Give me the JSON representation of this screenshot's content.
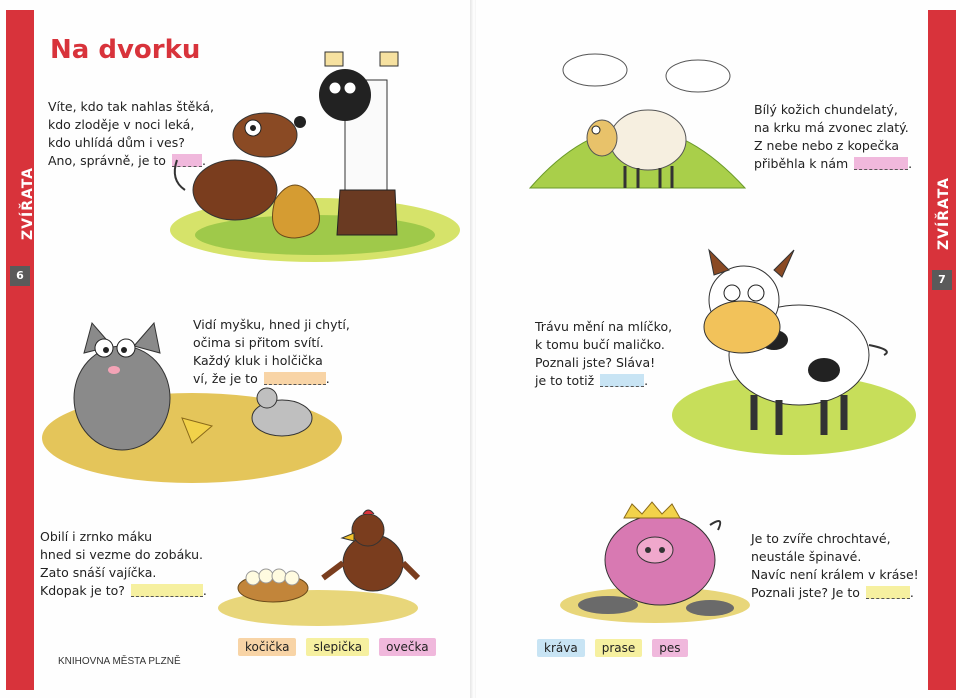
{
  "left_page": {
    "side_label": "ZVÍŘATA",
    "page_number": "6",
    "title": "Na dvorku",
    "poems": [
      {
        "lines": [
          "Víte, kdo tak nahlas štěká,",
          "kdo zloděje v noci leká,",
          "kdo uhlídá dům i ves?",
          "Ano, správně, je to"
        ],
        "blank_color": "#f0b8dc"
      },
      {
        "lines": [
          "Vidí myšku, hned ji chytí,",
          "očima si přitom svítí.",
          "Každý kluk i holčička",
          "ví, že je to"
        ],
        "blank_color": "#f8d4a6"
      },
      {
        "lines": [
          "Obilí i zrnko máku",
          "hned si vezme do zobáku.",
          "Zato snáší vajíčka.",
          "Kdopak je to?"
        ],
        "blank_color": "#f6f0a0"
      }
    ],
    "answer_chips": [
      {
        "label": "kočička",
        "color": "#f8d4a6"
      },
      {
        "label": "slepička",
        "color": "#f6f0a0"
      },
      {
        "label": "ovečka",
        "color": "#f0b8dc"
      }
    ],
    "footer": "KNIHOVNA MĚSTA PLZNĚ"
  },
  "right_page": {
    "side_label": "ZVÍŘATA",
    "page_number": "7",
    "poems": [
      {
        "lines": [
          "Bílý kožich chundelatý,",
          "na krku má zvonec zlatý.",
          "Z nebe nebo z kopečka",
          "přiběhla k nám"
        ],
        "blank_color": "#f0b8dc"
      },
      {
        "lines": [
          "Trávu mění na mlíčko,",
          "k tomu bučí maličko.",
          "Poznali jste? Sláva!",
          "je to totiž"
        ],
        "blank_color": "#c8e4f4"
      },
      {
        "lines": [
          "Je to zvíře chrochtavé,",
          "neustále špinavé.",
          "Navíc není králem v kráse!",
          "Poznali jste? Je to"
        ],
        "blank_color": "#f6f0a0"
      }
    ],
    "answer_chips": [
      {
        "label": "kráva",
        "color": "#c8e4f4"
      },
      {
        "label": "prase",
        "color": "#f6f0a0"
      },
      {
        "label": "pes",
        "color": "#f0b8dc"
      }
    ]
  },
  "illustrations": {
    "dog_scene": "dog-and-thief-illustration",
    "cat_scene": "cat-and-mouse-illustration",
    "hen_scene": "hen-and-eggs-illustration",
    "sheep_scene": "sheep-on-hill-illustration",
    "cow_scene": "cow-illustration",
    "pig_scene": "pig-with-crown-illustration"
  }
}
